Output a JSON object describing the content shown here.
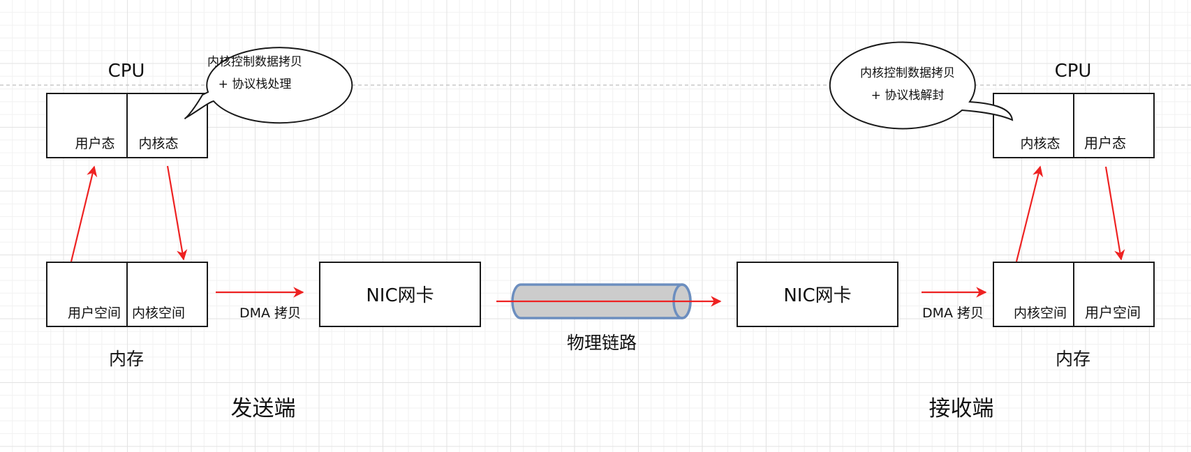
{
  "sender": {
    "title": "发送端",
    "cpu": {
      "label": "CPU",
      "left": "用户态",
      "right": "内核态"
    },
    "memory": {
      "label": "内存",
      "left": "用户空间",
      "right": "内核空间"
    },
    "callout": {
      "line1": "内核控制数据拷贝",
      "line2": "+ 协议栈处理"
    },
    "dma": "DMA 拷贝",
    "nic": "NIC网卡"
  },
  "receiver": {
    "title": "接收端",
    "cpu": {
      "label": "CPU",
      "left": "内核态",
      "right": "用户态"
    },
    "memory": {
      "label": "内存",
      "left": "内核空间",
      "right": "用户空间"
    },
    "callout": {
      "line1": "内核控制数据拷贝",
      "line2": "+ 协议栈解封"
    },
    "dma": "DMA 拷贝",
    "nic": "NIC网卡"
  },
  "link": {
    "label": "物理链路"
  },
  "colors": {
    "arrow": "#ee2222",
    "pipe_fill": "#cccccc",
    "pipe_stroke": "#6c8ebf",
    "box_stroke": "#1a1a1a"
  }
}
